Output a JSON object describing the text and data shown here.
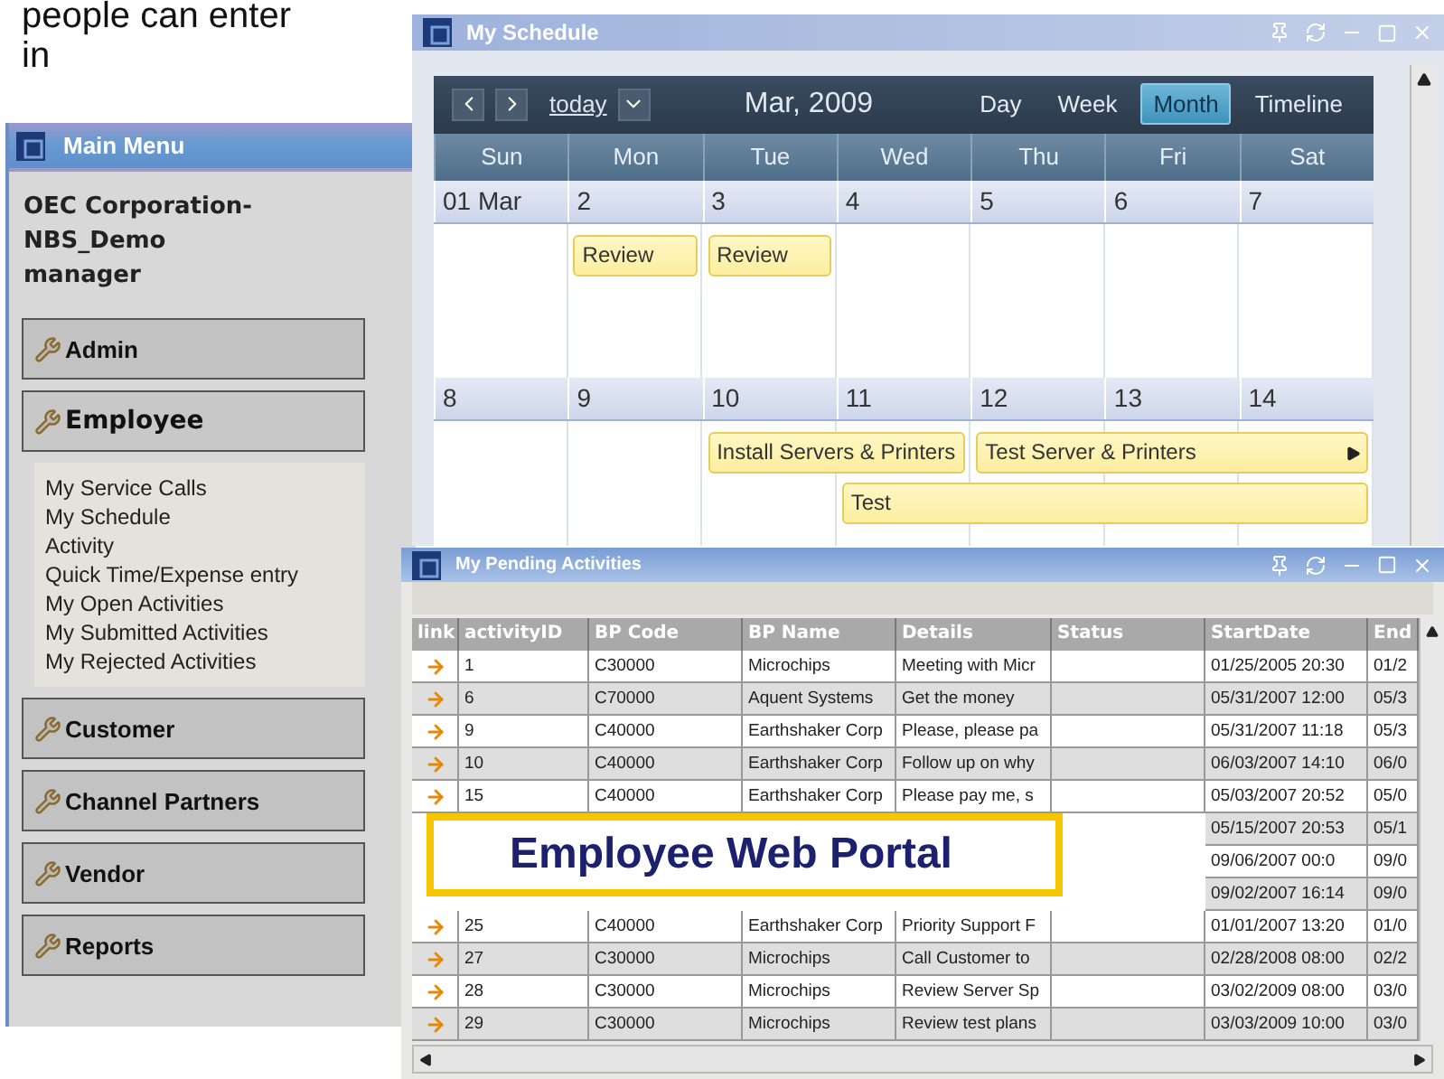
{
  "caption": [
    "people can enter",
    "in"
  ],
  "main_menu": {
    "title": "Main Menu",
    "account": [
      "OEC Corporation-",
      "NBS_Demo",
      "manager"
    ],
    "sections": [
      {
        "label": "Admin",
        "expanded": false
      },
      {
        "label": "Employee",
        "expanded": true,
        "items": [
          "My Service Calls",
          "My Schedule",
          "Activity",
          "Quick Time/Expense entry",
          "My Open Activities",
          "My Submitted Activities",
          "My Rejected Activities"
        ]
      },
      {
        "label": "Customer",
        "expanded": false
      },
      {
        "label": "Channel Partners",
        "expanded": false
      },
      {
        "label": "Vendor",
        "expanded": false
      },
      {
        "label": "Reports",
        "expanded": false
      }
    ]
  },
  "schedule": {
    "title": "My Schedule",
    "today": "today",
    "period": "Mar, 2009",
    "views": [
      {
        "label": "Day",
        "selected": false
      },
      {
        "label": "Week",
        "selected": false
      },
      {
        "label": "Month",
        "selected": true
      },
      {
        "label": "Timeline",
        "selected": false
      }
    ],
    "weekdays": [
      "Sun",
      "Mon",
      "Tue",
      "Wed",
      "Thu",
      "Fri",
      "Sat"
    ],
    "weeks": [
      {
        "days": [
          "01 Mar",
          "2",
          "3",
          "4",
          "5",
          "6",
          "7"
        ],
        "lanes": [
          [
            {
              "kind": "empty"
            },
            {
              "title": "Review",
              "more": false
            },
            {
              "title": "Review",
              "more": false
            },
            {
              "kind": "empty"
            },
            {
              "kind": "empty"
            },
            {
              "kind": "empty"
            },
            {
              "kind": "empty"
            }
          ]
        ]
      },
      {
        "days": [
          "8",
          "9",
          "10",
          "11",
          "12",
          "13",
          "14"
        ],
        "lanes": [
          [
            {
              "kind": "empty"
            },
            {
              "kind": "empty"
            },
            {
              "title": "Install Servers & Printers",
              "more": false
            },
            {
              "kind": "continued"
            },
            {
              "title": "Test Server & Printers",
              "more": true
            },
            {
              "kind": "continued"
            },
            {
              "kind": "continued"
            }
          ],
          [
            {
              "kind": "empty"
            },
            {
              "kind": "empty"
            },
            {
              "kind": "empty"
            },
            {
              "title": "Test",
              "more": false
            },
            {
              "kind": "continued"
            },
            {
              "kind": "continued"
            },
            {
              "kind": "continued"
            }
          ]
        ]
      }
    ]
  },
  "pending": {
    "title": "My Pending Activities",
    "columns": [
      "link",
      "activityID",
      "BP Code",
      "BP Name",
      "Details",
      "Status",
      "StartDate",
      "End"
    ],
    "rows": [
      {
        "kind": "row",
        "cells": [
          "",
          "1",
          "C30000",
          "Microchips",
          "Meeting with Micr",
          "",
          "01/25/2005 20:30",
          "01/2"
        ]
      },
      {
        "kind": "row",
        "cells": [
          "",
          "6",
          "C70000",
          "Aquent Systems",
          "Get the money",
          "",
          "05/31/2007 12:00",
          "05/3"
        ]
      },
      {
        "kind": "row",
        "cells": [
          "",
          "9",
          "C40000",
          "Earthshaker Corp",
          "Please, please pa",
          "",
          "05/31/2007 11:18",
          "05/3"
        ]
      },
      {
        "kind": "row",
        "cells": [
          "",
          "10",
          "C40000",
          "Earthshaker Corp",
          "Follow up on why",
          "",
          "06/03/2007 14:10",
          "06/0"
        ]
      },
      {
        "kind": "row",
        "cells": [
          "",
          "15",
          "C40000",
          "Earthshaker Corp",
          "Please pay me, s",
          "",
          "05/03/2007 20:52",
          "05/0"
        ]
      },
      {
        "kind": "covered",
        "cells": [
          "",
          "",
          "",
          "",
          "",
          "",
          "05/15/2007 20:53",
          "05/1"
        ]
      },
      {
        "kind": "covered",
        "cells": [
          "",
          "",
          "",
          "",
          "",
          "",
          "09/06/2007 00:0",
          "09/0"
        ]
      },
      {
        "kind": "covered",
        "cells": [
          "",
          "",
          "",
          "",
          "",
          "",
          "09/02/2007 16:14",
          "09/0"
        ]
      },
      {
        "kind": "row",
        "cells": [
          "",
          "25",
          "C40000",
          "Earthshaker Corp",
          "Priority Support F",
          "",
          "01/01/2007 13:20",
          "01/0"
        ]
      },
      {
        "kind": "row",
        "cells": [
          "",
          "27",
          "C30000",
          "Microchips",
          "Call Customer to",
          "",
          "02/28/2008 08:00",
          "02/2"
        ]
      },
      {
        "kind": "row",
        "cells": [
          "",
          "28",
          "C30000",
          "Microchips",
          "Review Server Sp",
          "",
          "03/02/2009 08:00",
          "03/0"
        ]
      },
      {
        "kind": "row",
        "cells": [
          "",
          "29",
          "C30000",
          "Microchips",
          "Review test plans",
          "",
          "03/03/2009 10:00",
          "03/0"
        ]
      }
    ]
  },
  "banner": "Employee Web Portal"
}
